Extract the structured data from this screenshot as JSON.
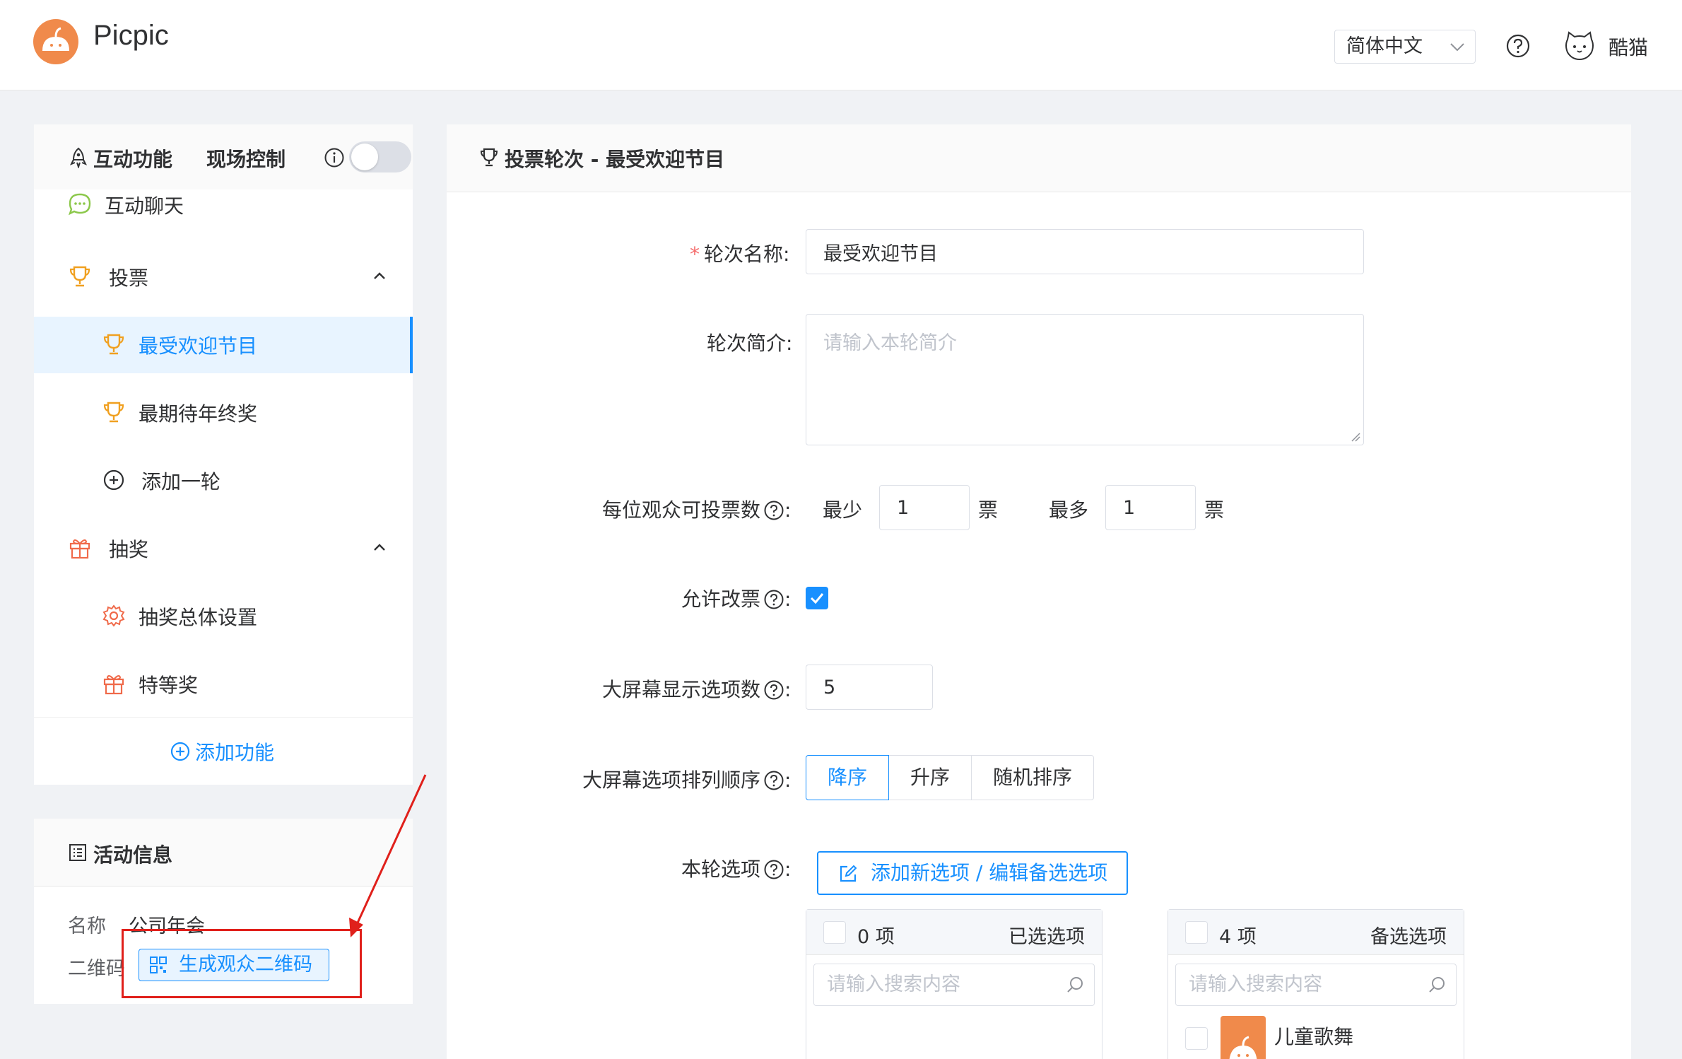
{
  "header": {
    "brand": "Picpic",
    "language": "简体中文",
    "username": "酷猫"
  },
  "sidebar": {
    "tab_interactive": "互动功能",
    "tab_live_control": "现场控制",
    "live_control_on": false,
    "items": [
      {
        "label": "互动聊天",
        "icon": "chat-bubble-icon"
      },
      {
        "label": "投票",
        "icon": "trophy-icon",
        "expanded": true
      },
      {
        "label": "最受欢迎节目",
        "icon": "trophy-icon",
        "active": true
      },
      {
        "label": "最期待年终奖",
        "icon": "trophy-icon"
      },
      {
        "label": "添加一轮",
        "icon": "plus-circle-icon"
      },
      {
        "label": "抽奖",
        "icon": "gift-icon",
        "expanded": true
      },
      {
        "label": "抽奖总体设置",
        "icon": "gear-icon"
      },
      {
        "label": "特等奖",
        "icon": "gift-icon"
      }
    ],
    "add_function": "添加功能"
  },
  "activity_info": {
    "title": "活动信息",
    "name_label": "名称",
    "name_value": "公司年会",
    "qr_label": "二维码",
    "qr_button": "生成观众二维码"
  },
  "main": {
    "title": "投票轮次 - 最受欢迎节目",
    "round_name_label": "轮次名称:",
    "round_name_value": "最受欢迎节目",
    "round_desc_label": "轮次简介:",
    "round_desc_placeholder": "请输入本轮简介",
    "votes_label": "每位观众可投票数",
    "votes_min_label": "最少",
    "votes_min_value": "1",
    "votes_max_label": "最多",
    "votes_max_value": "1",
    "votes_unit": "票",
    "allow_change_label": "允许改票",
    "allow_change_checked": true,
    "screen_count_label": "大屏幕显示选项数",
    "screen_count_value": "5",
    "screen_order_label": "大屏幕选项排列顺序",
    "order_options": [
      "降序",
      "升序",
      "随机排序"
    ],
    "order_selected": "降序",
    "options_label": "本轮选项",
    "add_option_button": "添加新选项 / 编辑备选选项",
    "selected_panel": {
      "count": "0 项",
      "title": "已选选项",
      "search_placeholder": "请输入搜索内容"
    },
    "candidate_panel": {
      "count": "4 项",
      "title": "备选选项",
      "search_placeholder": "请输入搜索内容",
      "first_item": "儿童歌舞"
    }
  },
  "colors": {
    "accent": "#1890ff",
    "brand_orange": "#f08a4b",
    "highlight_red": "#e0201b"
  }
}
